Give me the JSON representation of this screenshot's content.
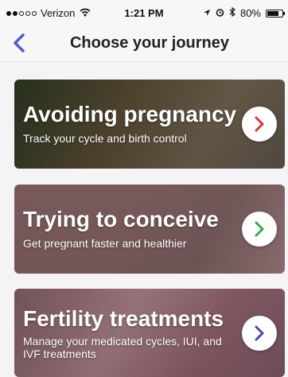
{
  "status_bar": {
    "carrier": "Verizon",
    "time": "1:21 PM",
    "battery": "80%",
    "battery_level": 0.8,
    "icons": [
      "signal-dots-icon",
      "wifi-icon",
      "location-arrow-icon",
      "alarm-icon",
      "bluetooth-icon",
      "battery-icon"
    ]
  },
  "nav": {
    "back_icon": "chevron-left-icon",
    "title": "Choose your journey"
  },
  "colors": {
    "accent": "#5b57c9",
    "chevron_red": "#d9343a",
    "chevron_green": "#3da84a",
    "chevron_blue": "#4b47b8"
  },
  "journeys": [
    {
      "title": "Avoiding pregnancy",
      "subtitle": "Track your cycle and birth control",
      "icon": "chevron-right-icon"
    },
    {
      "title": "Trying to conceive",
      "subtitle": "Get pregnant faster and healthier",
      "icon": "chevron-right-icon"
    },
    {
      "title": "Fertility treatments",
      "subtitle": "Manage your medicated cycles, IUI, and IVF treatments",
      "icon": "chevron-right-icon"
    }
  ]
}
